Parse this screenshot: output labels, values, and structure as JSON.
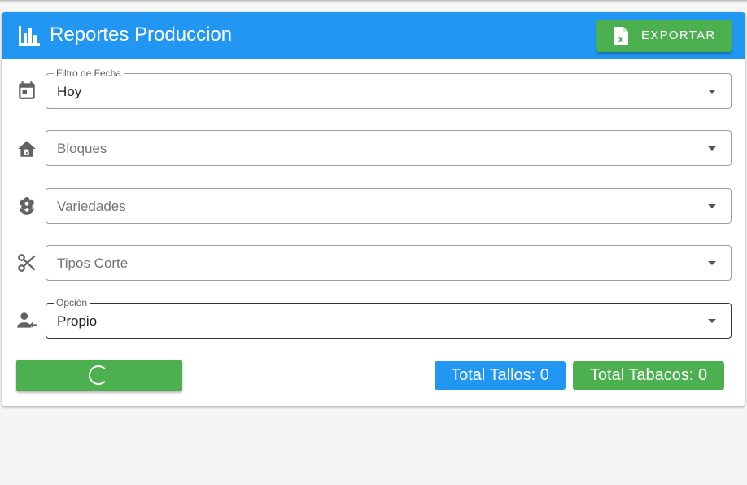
{
  "header": {
    "title": "Reportes Produccion",
    "export_label": "EXPORTAR",
    "background_color": "#2196f3",
    "title_icon": "bar-chart-icon",
    "export_icon": "excel-file-icon"
  },
  "filters": {
    "fecha": {
      "legend": "Filtro de Fecha",
      "value": "Hoy",
      "icon": "calendar-icon"
    },
    "bloques": {
      "placeholder": "Bloques",
      "icon": "home-building-icon"
    },
    "variedades": {
      "placeholder": "Variedades",
      "icon": "flower-icon"
    },
    "tipos_corte": {
      "placeholder": "Tipos Corte",
      "icon": "scissors-icon"
    },
    "opcion": {
      "legend": "Opción",
      "value": "Propio",
      "icon": "person-arrow-icon"
    }
  },
  "footer": {
    "load_button_state": "loading",
    "total_tallos": "Total Tallos: 0",
    "total_tabacos": "Total Tabacos: 0",
    "accent_green": "#4caf50",
    "accent_blue": "#2196f3"
  }
}
